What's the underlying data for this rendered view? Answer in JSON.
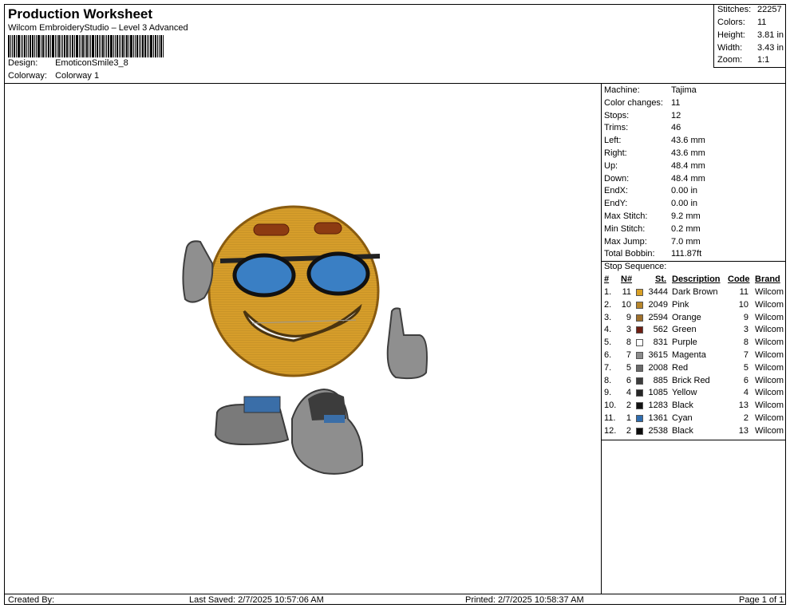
{
  "header": {
    "title": "Production Worksheet",
    "subtitle": "Wilcom EmbroideryStudio – Level 3 Advanced",
    "design_label": "Design:",
    "design_value": "EmoticonSmile3_8",
    "colorway_label": "Colorway:",
    "colorway_value": "Colorway 1"
  },
  "stats": [
    {
      "label": "Stitches:",
      "value": "22257"
    },
    {
      "label": "Colors:",
      "value": "11"
    },
    {
      "label": "Height:",
      "value": "3.81 in"
    },
    {
      "label": "Width:",
      "value": "3.43 in"
    },
    {
      "label": "Zoom:",
      "value": "1:1"
    }
  ],
  "machine": [
    {
      "label": "Machine:",
      "value": "Tajima"
    },
    {
      "label": "Color changes:",
      "value": "11"
    },
    {
      "label": "Stops:",
      "value": "12"
    },
    {
      "label": "Trims:",
      "value": "46"
    },
    {
      "label": "Left:",
      "value": "43.6 mm"
    },
    {
      "label": "Right:",
      "value": "43.6 mm"
    },
    {
      "label": "Up:",
      "value": "48.4 mm"
    },
    {
      "label": "Down:",
      "value": "48.4 mm"
    },
    {
      "label": "EndX:",
      "value": "0.00 in"
    },
    {
      "label": "EndY:",
      "value": "0.00 in"
    },
    {
      "label": "Max Stitch:",
      "value": "9.2 mm"
    },
    {
      "label": "Min Stitch:",
      "value": "0.2 mm"
    },
    {
      "label": "Max Jump:",
      "value": "7.0 mm"
    },
    {
      "label": "Total Bobbin:",
      "value": "111.87ft"
    }
  ],
  "sequence": {
    "title": "Stop Sequence:",
    "headers": {
      "num": "#",
      "needle": "N#",
      "stitches": "St.",
      "description": "Description",
      "code": "Code",
      "brand": "Brand"
    },
    "rows": [
      {
        "num": "1.",
        "needle": "11",
        "color": "#D9A025",
        "stitches": "3444",
        "description": "Dark Brown",
        "code": "11",
        "brand": "Wilcom"
      },
      {
        "num": "2.",
        "needle": "10",
        "color": "#B8862A",
        "stitches": "2049",
        "description": "Pink",
        "code": "10",
        "brand": "Wilcom"
      },
      {
        "num": "3.",
        "needle": "9",
        "color": "#A0702A",
        "stitches": "2594",
        "description": "Orange",
        "code": "9",
        "brand": "Wilcom"
      },
      {
        "num": "4.",
        "needle": "3",
        "color": "#6E1E12",
        "stitches": "562",
        "description": "Green",
        "code": "3",
        "brand": "Wilcom"
      },
      {
        "num": "5.",
        "needle": "8",
        "color": "#FFFFFF",
        "stitches": "831",
        "description": "Purple",
        "code": "8",
        "brand": "Wilcom"
      },
      {
        "num": "6.",
        "needle": "7",
        "color": "#8C8C8C",
        "stitches": "3615",
        "description": "Magenta",
        "code": "7",
        "brand": "Wilcom"
      },
      {
        "num": "7.",
        "needle": "5",
        "color": "#6A6A6A",
        "stitches": "2008",
        "description": "Red",
        "code": "5",
        "brand": "Wilcom"
      },
      {
        "num": "8.",
        "needle": "6",
        "color": "#3C3C3C",
        "stitches": "885",
        "description": "Brick Red",
        "code": "6",
        "brand": "Wilcom"
      },
      {
        "num": "9.",
        "needle": "4",
        "color": "#262626",
        "stitches": "1085",
        "description": "Yellow",
        "code": "4",
        "brand": "Wilcom"
      },
      {
        "num": "10.",
        "needle": "2",
        "color": "#121212",
        "stitches": "1283",
        "description": "Black",
        "code": "13",
        "brand": "Wilcom"
      },
      {
        "num": "11.",
        "needle": "1",
        "color": "#2F6DB0",
        "stitches": "1361",
        "description": "Cyan",
        "code": "2",
        "brand": "Wilcom"
      },
      {
        "num": "12.",
        "needle": "2",
        "color": "#0C0C0C",
        "stitches": "2538",
        "description": "Black",
        "code": "13",
        "brand": "Wilcom"
      }
    ]
  },
  "footer": {
    "created_by": "Created By:",
    "last_saved": "Last Saved: 2/7/2025 10:57:06 AM",
    "printed": "Printed: 2/7/2025 10:58:37 AM",
    "page": "Page 1 of 1"
  }
}
